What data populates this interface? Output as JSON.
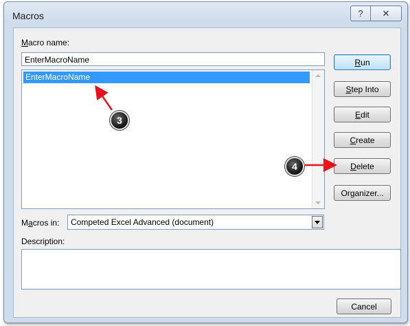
{
  "window": {
    "title": "Macros",
    "help_glyph": "?",
    "close_glyph": "✕"
  },
  "macro_name": {
    "label": "Macro name:",
    "label_mnemonic": "M",
    "label_rest": "acro name:",
    "value": "EnterMacroName"
  },
  "macro_list": {
    "items": [
      "EnterMacroName"
    ],
    "selected_index": 0
  },
  "buttons": {
    "run": {
      "mnemonic": "R",
      "rest": "un"
    },
    "step_into": {
      "mnemonic": "S",
      "rest": "tep Into"
    },
    "edit": {
      "mnemonic": "E",
      "rest": "dit"
    },
    "create": {
      "mnemonic": "C",
      "rest": "reate"
    },
    "delete": {
      "mnemonic": "D",
      "rest": "elete"
    },
    "organizer": {
      "prefix": "Or",
      "mnemonic": "g",
      "rest": "anizer..."
    },
    "cancel": "Cancel"
  },
  "macros_in": {
    "label_prefix": "M",
    "label_mnemonic": "a",
    "label_rest": "cros in:",
    "value": "Competed Excel Advanced (document)"
  },
  "description": {
    "label": "Description:",
    "value": ""
  },
  "annotations": {
    "marker_3": "3",
    "marker_4": "4",
    "arrow_color": "#e8141a"
  }
}
